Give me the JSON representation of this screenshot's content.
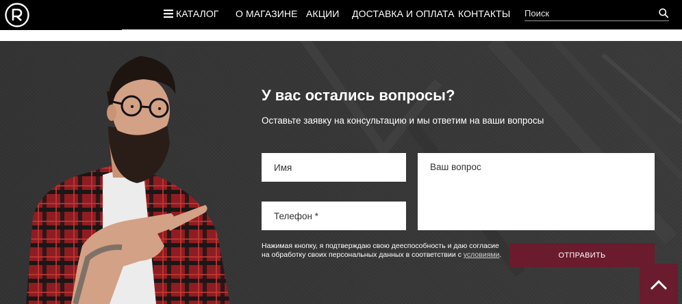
{
  "header": {
    "logo_letter": "R",
    "nav": [
      {
        "label": "КАТАЛОГ",
        "icon": "menu-icon"
      },
      {
        "label": "О МАГАЗИНЕ"
      },
      {
        "label": "АКЦИИ"
      },
      {
        "label": "ДОСТАВКА И ОПЛАТА"
      },
      {
        "label": "КОНТАКТЫ"
      }
    ],
    "search": {
      "placeholder": "Поиск",
      "icon": "search-icon"
    }
  },
  "form": {
    "title": "У вас остались вопросы?",
    "subtitle": "Оставьте заявку на консультацию и мы ответим на ваши вопросы",
    "name_placeholder": "Имя",
    "phone_placeholder": "Телефон *",
    "question_placeholder": "Ваш вопрос",
    "consent_text": "Нажимая кнопку, я подтверждаю свою дееспособность и даю согласие на обработку своих персональных данных в соответствии с ",
    "consent_link": "условиями",
    "consent_end": ".",
    "submit_label": "ОТПРАВИТЬ"
  },
  "colors": {
    "header_bg": "#000000",
    "banner_bg": "#3a3a3a",
    "accent": "#6a1b2d"
  },
  "scroll_top": {
    "icon": "chevron-up-icon"
  }
}
